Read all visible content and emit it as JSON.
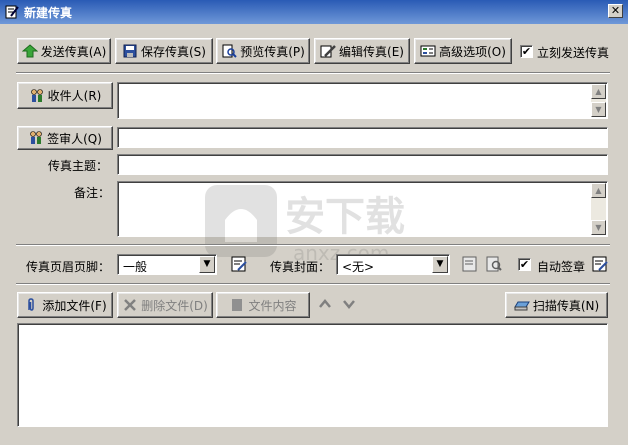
{
  "window": {
    "title": "新建传真",
    "close_label": "✕"
  },
  "toolbar": {
    "send": "发送传真(A)",
    "save": "保存传真(S)",
    "preview": "预览传真(P)",
    "edit": "编辑传真(E)",
    "advanced": "高级选项(O)",
    "send_now": "立刻发送传真",
    "send_now_checked": "✔"
  },
  "form": {
    "recipient_button": "收件人(R)",
    "approver_button": "签审人(Q)",
    "subject_label": "传真主题：",
    "note_label": "备注："
  },
  "options": {
    "header_footer_label": "传真页眉页脚：",
    "header_footer_value": "一般",
    "cover_label": "传真封面：",
    "cover_value": "<无>",
    "auto_sign_label": "自动签章",
    "auto_sign_checked": "✔"
  },
  "files": {
    "add": "添加文件(F)",
    "delete": "删除文件(D)",
    "content": "文件内容",
    "scan": "扫描传真(N)"
  },
  "watermark": {
    "brand": "安下载",
    "domain": "anxz.com"
  },
  "colors": {
    "title_start": "#2a5bb5",
    "title_end": "#6f98d8",
    "face": "#d4d0c8"
  }
}
